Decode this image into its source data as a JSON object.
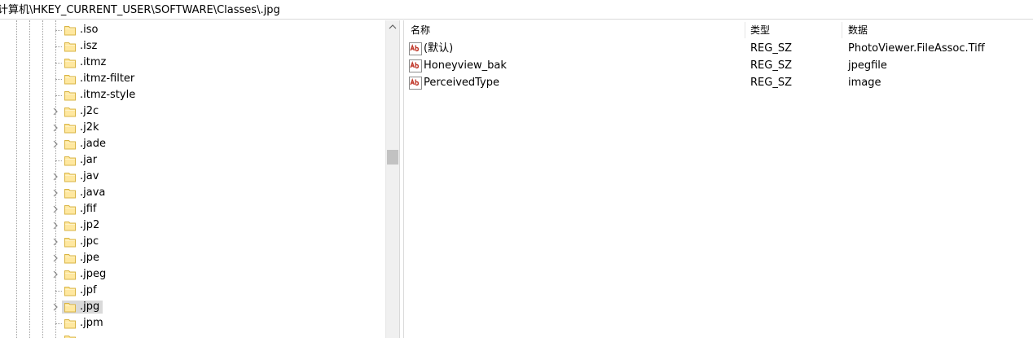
{
  "address_bar": {
    "path": "计算机\\HKEY_CURRENT_USER\\SOFTWARE\\Classes\\.jpg"
  },
  "tree": {
    "items": [
      {
        "label": ".iso",
        "expandable": false,
        "selected": false
      },
      {
        "label": ".isz",
        "expandable": false,
        "selected": false
      },
      {
        "label": ".itmz",
        "expandable": false,
        "selected": false
      },
      {
        "label": ".itmz-filter",
        "expandable": false,
        "selected": false
      },
      {
        "label": ".itmz-style",
        "expandable": false,
        "selected": false
      },
      {
        "label": ".j2c",
        "expandable": true,
        "selected": false
      },
      {
        "label": ".j2k",
        "expandable": true,
        "selected": false
      },
      {
        "label": ".jade",
        "expandable": true,
        "selected": false
      },
      {
        "label": ".jar",
        "expandable": false,
        "selected": false
      },
      {
        "label": ".jav",
        "expandable": true,
        "selected": false
      },
      {
        "label": ".java",
        "expandable": true,
        "selected": false
      },
      {
        "label": ".jfif",
        "expandable": true,
        "selected": false
      },
      {
        "label": ".jp2",
        "expandable": true,
        "selected": false
      },
      {
        "label": ".jpc",
        "expandable": true,
        "selected": false
      },
      {
        "label": ".jpe",
        "expandable": true,
        "selected": false
      },
      {
        "label": ".jpeg",
        "expandable": true,
        "selected": false
      },
      {
        "label": ".jpf",
        "expandable": false,
        "selected": false
      },
      {
        "label": ".jpg",
        "expandable": true,
        "selected": true
      },
      {
        "label": ".jpm",
        "expandable": false,
        "selected": false
      },
      {
        "label": "",
        "expandable": false,
        "selected": false
      }
    ]
  },
  "values_pane": {
    "columns": {
      "name": "名称",
      "type": "类型",
      "data": "数据"
    },
    "rows": [
      {
        "name": "(默认)",
        "type": "REG_SZ",
        "data": "PhotoViewer.FileAssoc.Tiff",
        "icon": "string-value-icon"
      },
      {
        "name": "Honeyview_bak",
        "type": "REG_SZ",
        "data": "jpegfile",
        "icon": "string-value-icon"
      },
      {
        "name": "PerceivedType",
        "type": "REG_SZ",
        "data": "image",
        "icon": "string-value-icon"
      }
    ]
  },
  "colors": {
    "folder_fill": "#FFE8A0",
    "folder_stroke": "#D9B443",
    "selection": "#D9D9D9",
    "ab_red": "#C0392B"
  }
}
